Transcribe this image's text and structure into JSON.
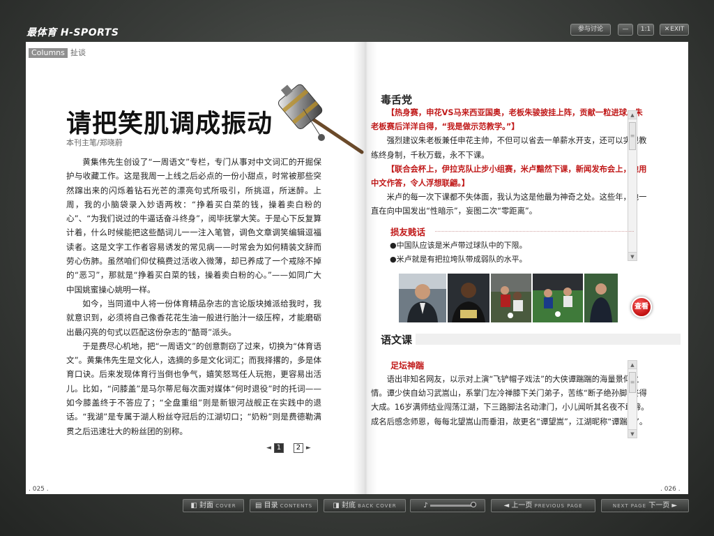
{
  "app": {
    "logo": "最体育 H-SPORTS"
  },
  "topbar": {
    "discuss": "参与讨论",
    "minimize": "—",
    "ratio": "1:1",
    "exit": "EXIT"
  },
  "left_page": {
    "column_tag": "Columns",
    "column_zh": "扯谈",
    "title": "请把笑肌调成振动",
    "byline": "本刊主笔/郑晓蔚",
    "paragraphs": [
      "黄集伟先生创设了“一周语文”专栏，专门从事对中文词汇的开掘保护与收藏工作。这是我周一上线之后必点的一份小甜点，时常被那些突然蹿出来的闪烁着钻石光芒的漂亮句式所吸引，所挑逗，所迷醉。上周，我的小脑袋录入妙语两枚：“挣着买白菜的钱，操着卖白粉的心”、“为我们说过的牛逼话奋斗终身”，阅毕抚掌大笑。于是心下反复算计着，什么时候能把这些酷词儿一一注入笔管，调色文章调笑编辑逗福读者。这是文字工作者容易诱发的常见病——时常会为如何精装文辞而劳心伤肺。虽然咱们仰仗稿费过活收入微薄，却已养成了一个戒除不掉的“恶习”，那就是“挣着买白菜的钱，操着卖白粉的心。”——如同广大中国姚蜜操心姚明一样。",
      "如今，当同道中人将一份体育精品杂志的言论版块摊派给我时，我就意识到，必须将自己像香花花生油一般进行胎汁一级压榨，才能磨砺出最闪亮的句式以匹配这份杂志的“酷哥”派头。",
      "于是费尽心机地，把“一周语文”的创意剽窃了过来，切换为“体育语文”。黄集伟先生是文化人，选摘的多是文化词汇；而我择撂的，多是体育口诀。后来发现体育行当倒也争气，嬉笑怒骂任人玩抱，更容易出活儿。比如，“问膝盖”是马尔蒂尼每次面对媒体“何时退役”时的托词——如今膝盖终于不答应了；“全盘重组”则是新银河战舰正在实践中的退话。“我湖”是专属于湖人粉丝夺冠后的江湖切口；“奶粉”则是费德勒满贯之后迅速壮大的粉丝团的别称。"
    ],
    "pager": {
      "p1": "1",
      "p2": "2"
    },
    "folio": ". 025 ."
  },
  "right_page": {
    "section1": "毒舌党",
    "dushe": [
      {
        "text": "【热身赛，申花VS马来西亚国奥，老板朱骏披挂上阵，贡献一粒进球。朱老板赛后洋洋自得，“我是做示范教学。”】",
        "style": "red"
      },
      {
        "text": "强烈建议朱老板兼任申花主帅，不但可以省去一单薪水开支，还可以实现教练终身制，千秋万载，永不下课。",
        "style": "ind"
      },
      {
        "text": "【联合会杯上，伊拉克队止步小组赛，米卢黯然下课，新闻发布会上，他用中文作答，令人浮想联翩。】",
        "style": "red"
      },
      {
        "text": "米卢的每一次下课都不失体面，我认为这是他最为神奇之处。这些年，他一直在向中国发出“性暗示”，妄图二次“零距离”。",
        "style": "ind"
      }
    ],
    "sunyou": {
      "title": "损友贱话",
      "bullets": [
        "●中国队应该是米卢带过球队中的下限。",
        "●米卢就是有把拉垮队带成弱队的水平。"
      ]
    },
    "view_button": "查看",
    "section2": "语文课",
    "yuwen": {
      "heading": "足坛神踹",
      "text": "语出非知名网友，以示对上演“飞铲帽子戏法”的大侠谭踹踹的海量景仰之情。谭少侠自幼习武嵩山，系掌门左冷禅膝下关门弟子，苦练“断子绝孙脚”终得大成。16岁满师结业闯荡江湖，下三路脚法名动津门，小儿闻听其名夜不敢啼。成名后感念师恩，每每北望嵩山而垂泪，故更名“谭望嵩”，江湖昵称“谭踹踹”。"
    },
    "folio": ". 026 ."
  },
  "bottom_nav": {
    "cover": {
      "zh": "封面",
      "en": "COVER"
    },
    "contents": {
      "zh": "目录",
      "en": "CONTENTS"
    },
    "back_cover": {
      "zh": "封底",
      "en": "BACK COVER"
    },
    "volume": "♪",
    "prev": {
      "zh": "上一页",
      "en": "PREVIOUS PAGE"
    },
    "next": {
      "zh": "下一页",
      "en": "NEXT PAGE"
    }
  }
}
